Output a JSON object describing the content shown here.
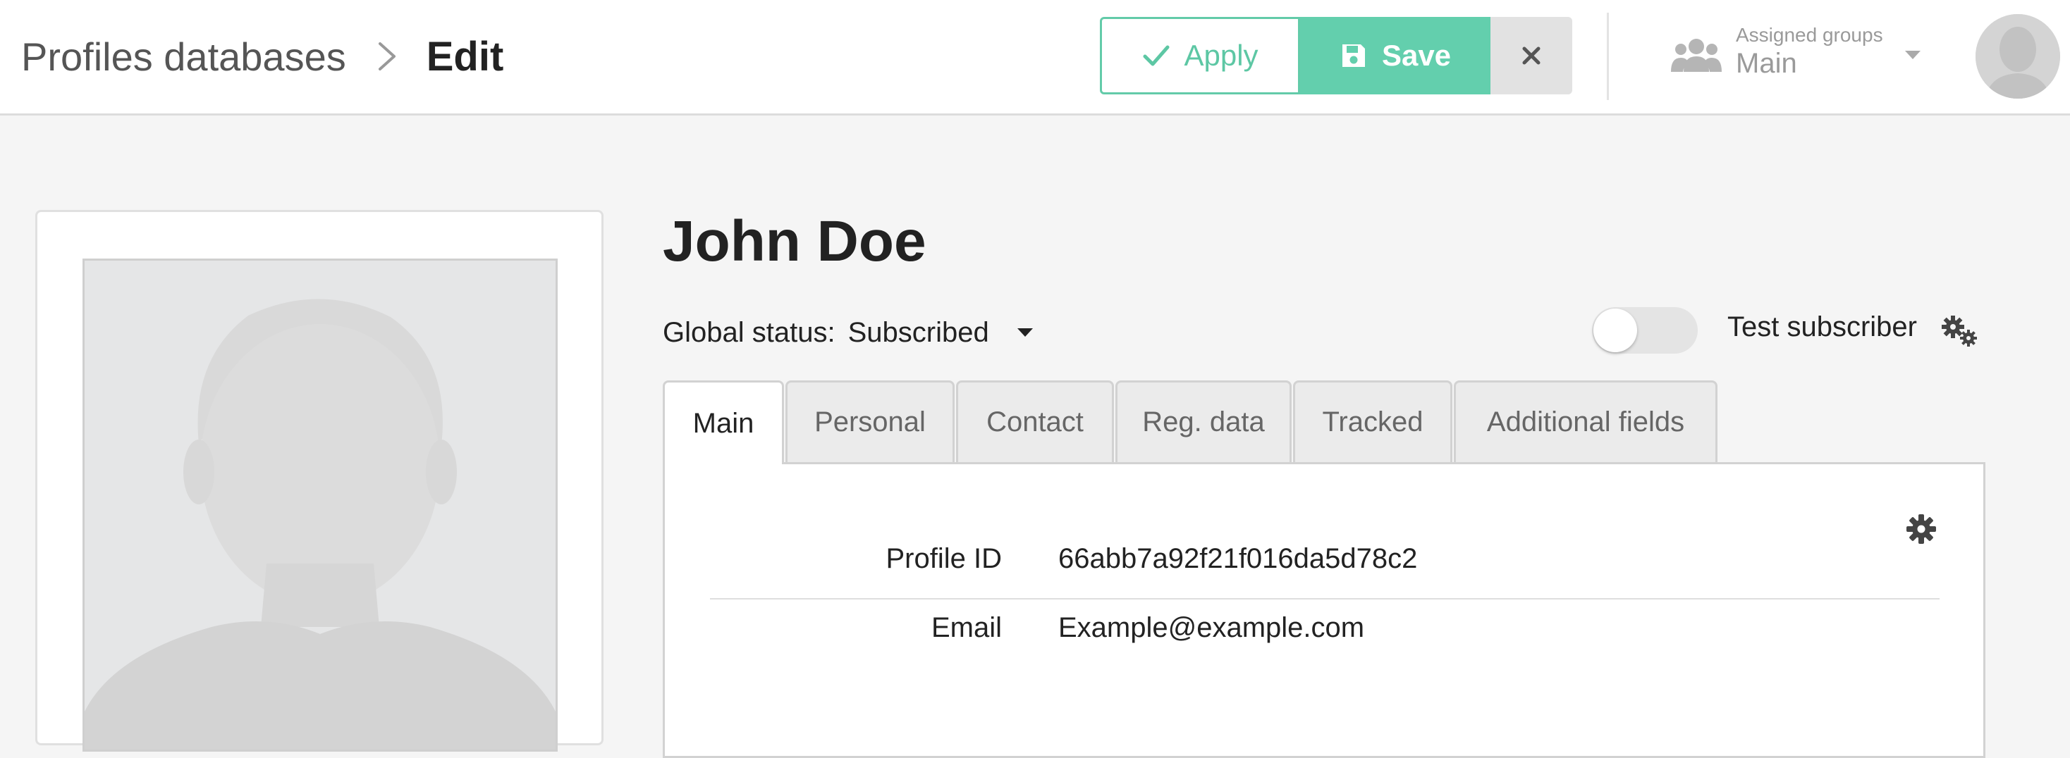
{
  "header": {
    "breadcrumb_root": "Profiles databases",
    "breadcrumb_current": "Edit",
    "apply_label": "Apply",
    "save_label": "Save",
    "assigned_groups_caption": "Assigned groups",
    "assigned_groups_value": "Main"
  },
  "profile": {
    "name": "John Doe",
    "global_status_label": "Global status:",
    "global_status_value": "Subscribed",
    "test_subscriber_label": "Test subscriber",
    "test_subscriber_enabled": false
  },
  "tabs": [
    {
      "label": "Main",
      "active": true
    },
    {
      "label": "Personal",
      "active": false
    },
    {
      "label": "Contact",
      "active": false
    },
    {
      "label": "Reg. data",
      "active": false
    },
    {
      "label": "Tracked",
      "active": false
    },
    {
      "label": "Additional fields",
      "active": false
    }
  ],
  "fields": [
    {
      "label": "Profile ID",
      "value": "66abb7a92f21f016da5d78c2"
    },
    {
      "label": "Email",
      "value": "Example@example.com"
    }
  ],
  "colors": {
    "accent": "#63cfad",
    "apply_border": "#63cba9",
    "background": "#f5f5f5"
  },
  "icons": {
    "apply": "check-icon",
    "save": "floppy-disk-icon",
    "close": "close-icon",
    "groups": "users-group-icon",
    "settings": "gears-icon",
    "panel_settings": "gear-icon"
  }
}
